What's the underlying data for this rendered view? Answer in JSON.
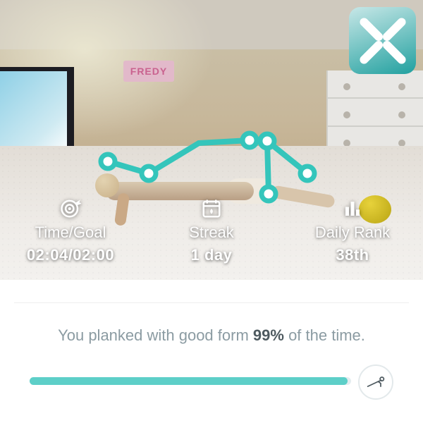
{
  "scene": {
    "sign_text": "FREDY"
  },
  "colors": {
    "accent": "#34c5bb",
    "accent_soft": "#5dcfc8",
    "text_muted": "#8b9ba2"
  },
  "stats": {
    "time_goal": {
      "label": "Time/Goal",
      "value": "02:04/02:00"
    },
    "streak": {
      "label": "Streak",
      "value": "1 day"
    },
    "rank": {
      "label": "Daily Rank",
      "value": "38th"
    }
  },
  "form_feedback": {
    "prefix": "You planked with good form ",
    "percent": "99%",
    "suffix": " of the time.",
    "progress_percent": 99
  }
}
